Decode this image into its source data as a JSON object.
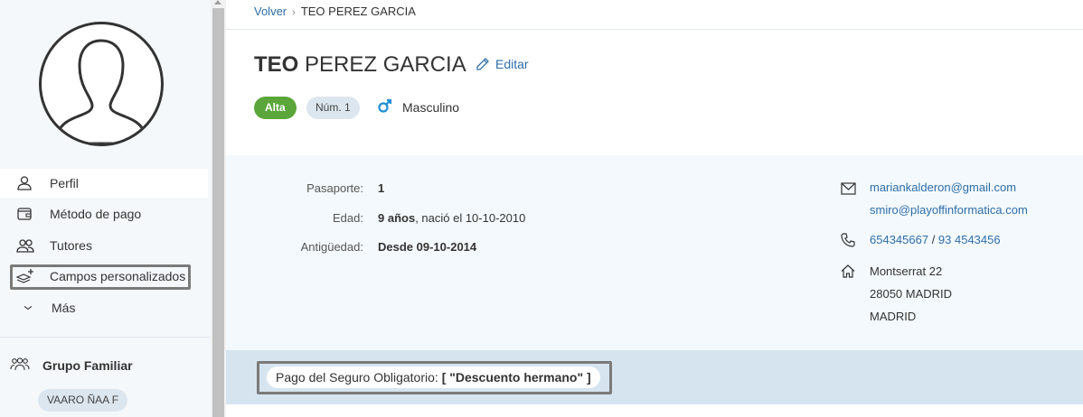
{
  "sidebar": {
    "items": [
      {
        "label": "Perfil",
        "icon": "user-icon",
        "active": true
      },
      {
        "label": "Método de pago",
        "icon": "wallet-icon"
      },
      {
        "label": "Tutores",
        "icon": "users-icon"
      },
      {
        "label": "Campos personalizados",
        "icon": "layers-plus-icon"
      },
      {
        "label": "Más",
        "icon": "chevron-down-icon"
      }
    ],
    "group_title": "Grupo Familiar",
    "group_member": "VAARO ÑAA F"
  },
  "breadcrumb": {
    "back": "Volver",
    "separator": "›",
    "current": "TEO PEREZ GARCIA"
  },
  "header": {
    "first_name": "TEO",
    "last_name": "PEREZ GARCIA",
    "edit_label": "Editar"
  },
  "badges": {
    "status": "Alta",
    "number": "Núm. 1",
    "gender": "Masculino"
  },
  "info": {
    "passport_label": "Pasaporte:",
    "passport_value": "1",
    "age_label": "Edad:",
    "age_value": "9 años",
    "age_birth": ", nació el 10-10-2010",
    "seniority_label": "Antigüedad:",
    "seniority_value": "Desde 09-10-2014"
  },
  "contact": {
    "email_1": "mariankalderon@gmail.com",
    "email_2": "smiro@playoffinformatica.com",
    "phone_1": "654345667",
    "phone_sep": " / ",
    "phone_2": "93 4543456",
    "address_line_1": "Montserrat 22",
    "address_line_2": "28050 MADRID",
    "address_line_3": "MADRID"
  },
  "custom_field": {
    "label": "Pago del Seguro Obligatorio: ",
    "value": "[ \"Descuento hermano\" ]"
  },
  "colors": {
    "accent": "#2f6ea8",
    "status_green": "#5ba63a",
    "panel_bg": "#f3f9fc",
    "custom_bar_bg": "#d6e4ef"
  }
}
